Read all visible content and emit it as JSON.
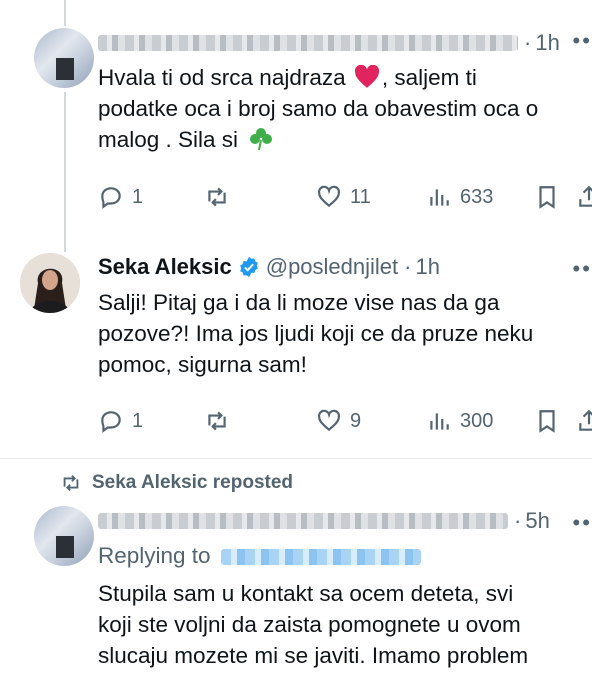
{
  "tweet1": {
    "time": "1h",
    "lines": [
      "Hvala ti od srca najdraza",
      ", saljem ti",
      "podatke oca i broj samo da obavestim oca o",
      "malog . Sila si"
    ],
    "stats": {
      "replies": "1",
      "likes": "11",
      "views": "633"
    }
  },
  "tweet2": {
    "name": "Seka Aleksic",
    "handle": "@poslednjilet",
    "time": "1h",
    "lines": [
      "Salji! Pitaj ga i da li moze vise nas da ga",
      "pozove?! Ima jos ljudi koji ce da pruze neku",
      "pomoc, sigurna sam!"
    ],
    "stats": {
      "replies": "1",
      "likes": "9",
      "views": "300"
    }
  },
  "repost_banner": "Seka Aleksic reposted",
  "tweet3": {
    "time": "5h",
    "replying_to": "Replying to",
    "lines": [
      "Stupila sam u kontakt sa ocem deteta, svi",
      "koji ste voljni da zaista pomognete u ovom",
      "slucaju mozete mi se javiti. Imamo problem"
    ]
  },
  "colors": {
    "accent": "#1d9bf0",
    "muted": "#536471",
    "heart": "#e0245e",
    "clover": "#3fae49"
  },
  "icons": [
    "reply-icon",
    "retweet-icon",
    "like-icon",
    "views-icon",
    "bookmark-icon",
    "share-icon",
    "verified-icon",
    "heart-emoji-icon",
    "clover-emoji-icon",
    "more-icon"
  ]
}
